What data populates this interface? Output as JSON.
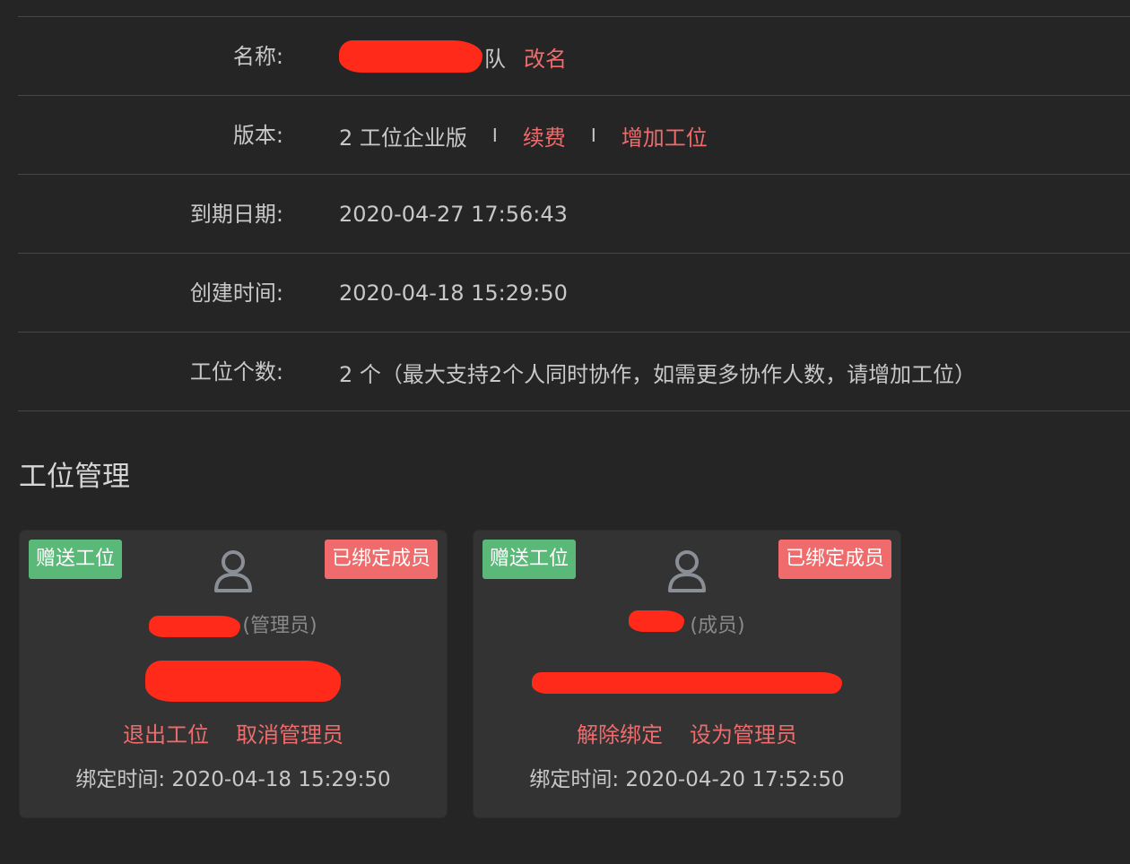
{
  "info": {
    "name_label": "名称:",
    "name_suffix": "队",
    "rename_link": "改名",
    "version_label": "版本:",
    "version_value": "2 工位企业版",
    "separator": "I",
    "renew_link": "续费",
    "add_seat_link": "增加工位",
    "expire_label": "到期日期:",
    "expire_value": "2020-04-27 17:56:43",
    "created_label": "创建时间:",
    "created_value": "2020-04-18 15:29:50",
    "seats_label": "工位个数:",
    "seats_value": "2 个（最大支持2个人同时协作，如需更多协作人数，请增加工位）"
  },
  "section_title": "工位管理",
  "cards": [
    {
      "gift_tag": "赠送工位",
      "bound_tag": "已绑定成员",
      "role": "(管理员)",
      "action_1": "退出工位",
      "action_2": "取消管理员",
      "bind_time": "绑定时间: 2020-04-18 15:29:50"
    },
    {
      "gift_tag": "赠送工位",
      "bound_tag": "已绑定成员",
      "role": "(成员)",
      "action_1": "解除绑定",
      "action_2": "设为管理员",
      "bind_time": "绑定时间: 2020-04-20 17:52:50"
    }
  ],
  "colors": {
    "background": "#252526",
    "card": "#333334",
    "link_red": "#f06b6b",
    "tag_green": "#5ab878",
    "redaction": "#ff2a1a"
  },
  "icons": [
    "user-avatar-icon"
  ]
}
